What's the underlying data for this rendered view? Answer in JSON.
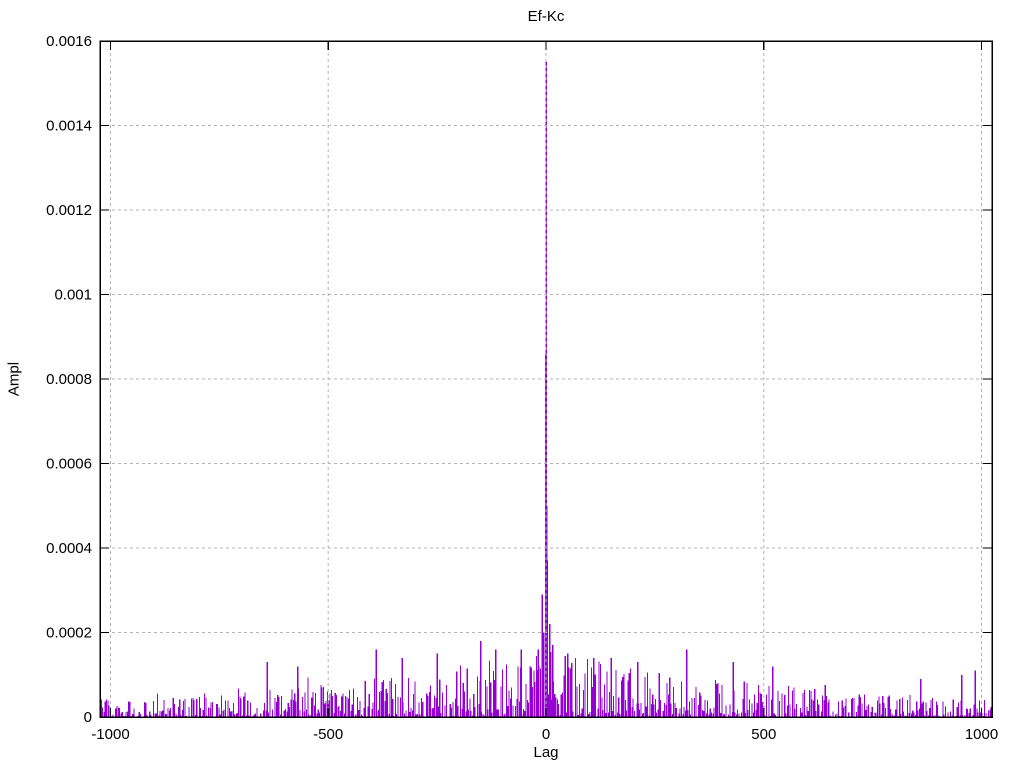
{
  "window": {
    "background_color": "#ffffff"
  },
  "chart_data": {
    "type": "line",
    "style": "impulses",
    "title": "Ef-Kc",
    "xlabel": "Lag",
    "ylabel": "Ampl",
    "xlim": [
      -1024,
      1024
    ],
    "ylim": [
      0,
      0.0016
    ],
    "xticks": [
      {
        "value": -1000,
        "label": "-1000"
      },
      {
        "value": -500,
        "label": "-500"
      },
      {
        "value": 0,
        "label": "0"
      },
      {
        "value": 500,
        "label": "500"
      },
      {
        "value": 1000,
        "label": "1000"
      }
    ],
    "yticks": [
      {
        "value": 0,
        "label": "0"
      },
      {
        "value": 0.0002,
        "label": "0.0002"
      },
      {
        "value": 0.0004,
        "label": "0.0004"
      },
      {
        "value": 0.0006,
        "label": "0.0006"
      },
      {
        "value": 0.0008,
        "label": "0.0008"
      },
      {
        "value": 0.001,
        "label": "0.001"
      },
      {
        "value": 0.0012,
        "label": "0.0012"
      },
      {
        "value": 0.0014,
        "label": "0.0014"
      },
      {
        "value": 0.0016,
        "label": "0.0016"
      }
    ],
    "grid": true,
    "legend_position": "none",
    "line_color": "#9400d3",
    "grid_color": "#b3b3b3",
    "axis_color": "#000000",
    "main_peaks": [
      [
        -18,
        0.00016
      ],
      [
        -9,
        0.00029
      ],
      [
        -5,
        0.0002
      ],
      [
        -1,
        0.00086
      ],
      [
        0,
        0.00155
      ],
      [
        1,
        0.00124
      ],
      [
        2,
        0.0005
      ],
      [
        3,
        0.00037
      ],
      [
        8,
        0.00022
      ],
      [
        15,
        0.00017
      ]
    ],
    "extra_spikes": [
      [
        -640,
        0.00013
      ],
      [
        -570,
        0.00012
      ],
      [
        -390,
        0.00016
      ],
      [
        -330,
        0.00014
      ],
      [
        -250,
        0.00015
      ],
      [
        -150,
        0.00018
      ],
      [
        -115,
        0.00016
      ],
      [
        -57,
        0.00016
      ],
      [
        50,
        0.00015
      ],
      [
        110,
        0.00014
      ],
      [
        150,
        0.00014
      ],
      [
        210,
        0.00013
      ],
      [
        323,
        0.00016
      ],
      [
        430,
        0.00013
      ],
      [
        520,
        0.00012
      ],
      [
        860,
        9e-05
      ],
      [
        955,
        0.0001
      ],
      [
        985,
        0.00011
      ]
    ],
    "noise_model": {
      "description": "dense zero-baseline impulse noise, amplitude tapering from ~0.00014 near lag 0 to ~0.00003 at |lag|=1000",
      "seed": 20240521,
      "lag_step": 3,
      "base": 4.2e-05,
      "amp": 0.000118,
      "falloff_exp": 1.7,
      "shape_exp": 1.6,
      "spike_prob": 0.04
    }
  }
}
